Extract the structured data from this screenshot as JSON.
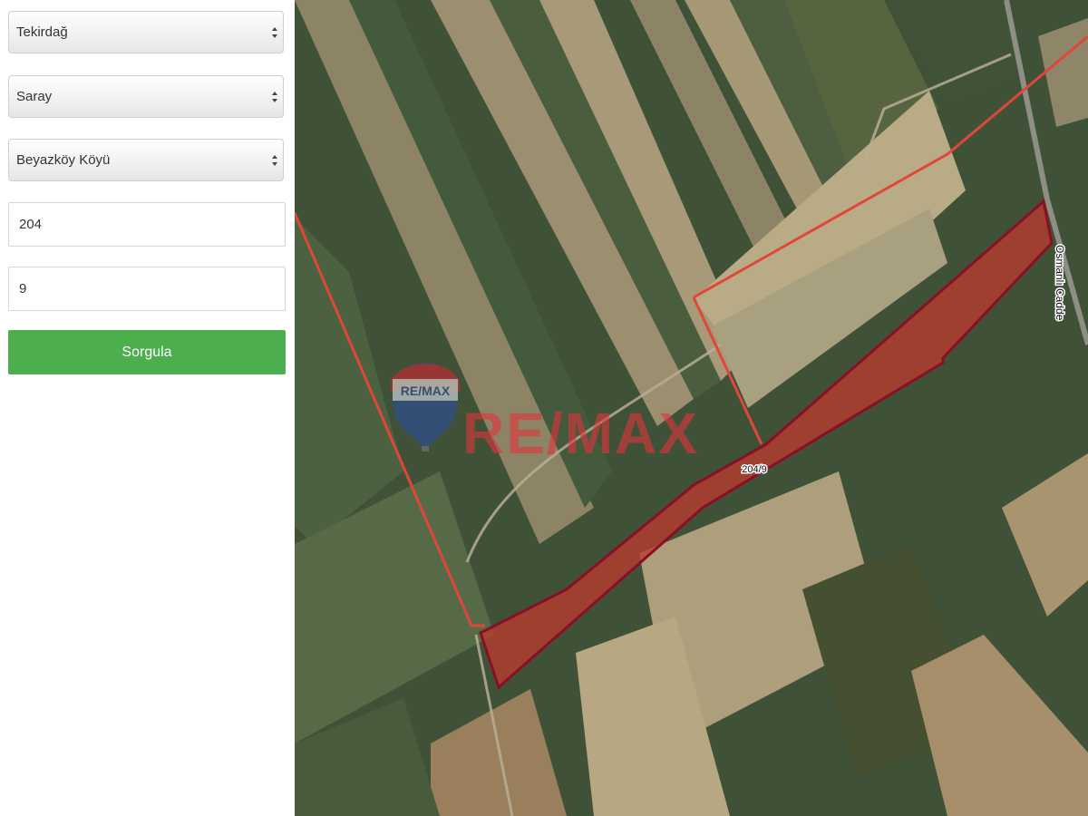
{
  "form": {
    "province": "Tekirdağ",
    "district": "Saray",
    "neighborhood": "Beyazköy Köyü",
    "block": "204",
    "parcel": "9",
    "submit_label": "Sorgula"
  },
  "map": {
    "parcel_label": "204/9",
    "street_label": "Osmanlı Cadde",
    "watermark_text": "RE/MAX",
    "balloon_text": "RE/MAX",
    "colors": {
      "parcel_fill": "#b83a2e",
      "parcel_outline": "#8a0f24",
      "boundary_line": "#e0463a",
      "button_green": "#4cae4c"
    }
  }
}
